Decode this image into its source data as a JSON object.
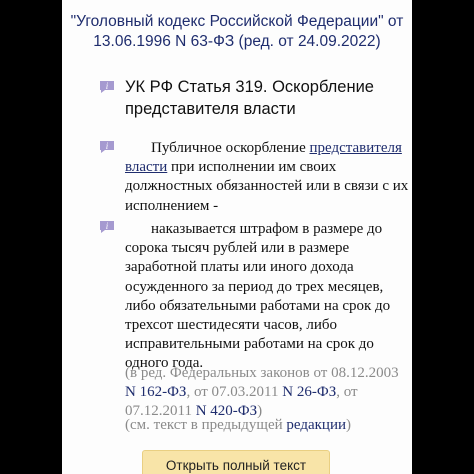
{
  "document": {
    "title": "\"Уголовный кодекс Российской Федерации\" от 13.06.1996 N 63-ФЗ (ред. от 24.09.2022)"
  },
  "article": {
    "title": "УК РФ Статья 319. Оскорбление представителя власти",
    "para1": {
      "prefix": "Публичное оскорбление",
      "link": "представителя власти",
      "suffix": "при исполнении им своих должностных обязанностей или в связи с их исполнением -"
    },
    "para2": "наказывается штрафом в размере до сорока тысяч рублей или в размере заработной платы или иного дохода осужденного за период до трех месяцев, либо обязательными работами на срок до трехсот шестидесяти часов, либо исправительными работами на срок до одного года.",
    "amendments": {
      "prefix": "(в ред. Федеральных законов от 08.12.2003",
      "law1": "N 162-ФЗ",
      "mid1": ", от 07.03.2011",
      "law2": "N 26-ФЗ",
      "mid2": ", от 07.12.2011",
      "law3": "N 420-ФЗ",
      "suffix": ")"
    },
    "see_text": {
      "prefix": "(см. текст в предыдущей",
      "link": "редакции",
      "suffix": ")"
    }
  },
  "button": {
    "open_full_text": "Открыть полный текст документа"
  },
  "icons": {
    "info": "info-icon"
  },
  "colors": {
    "title_blue": "#1f2d6e",
    "icon_purple": "#a59ad0",
    "note_gray": "#8a8a8a",
    "button_bg": "#f8e4a8"
  }
}
